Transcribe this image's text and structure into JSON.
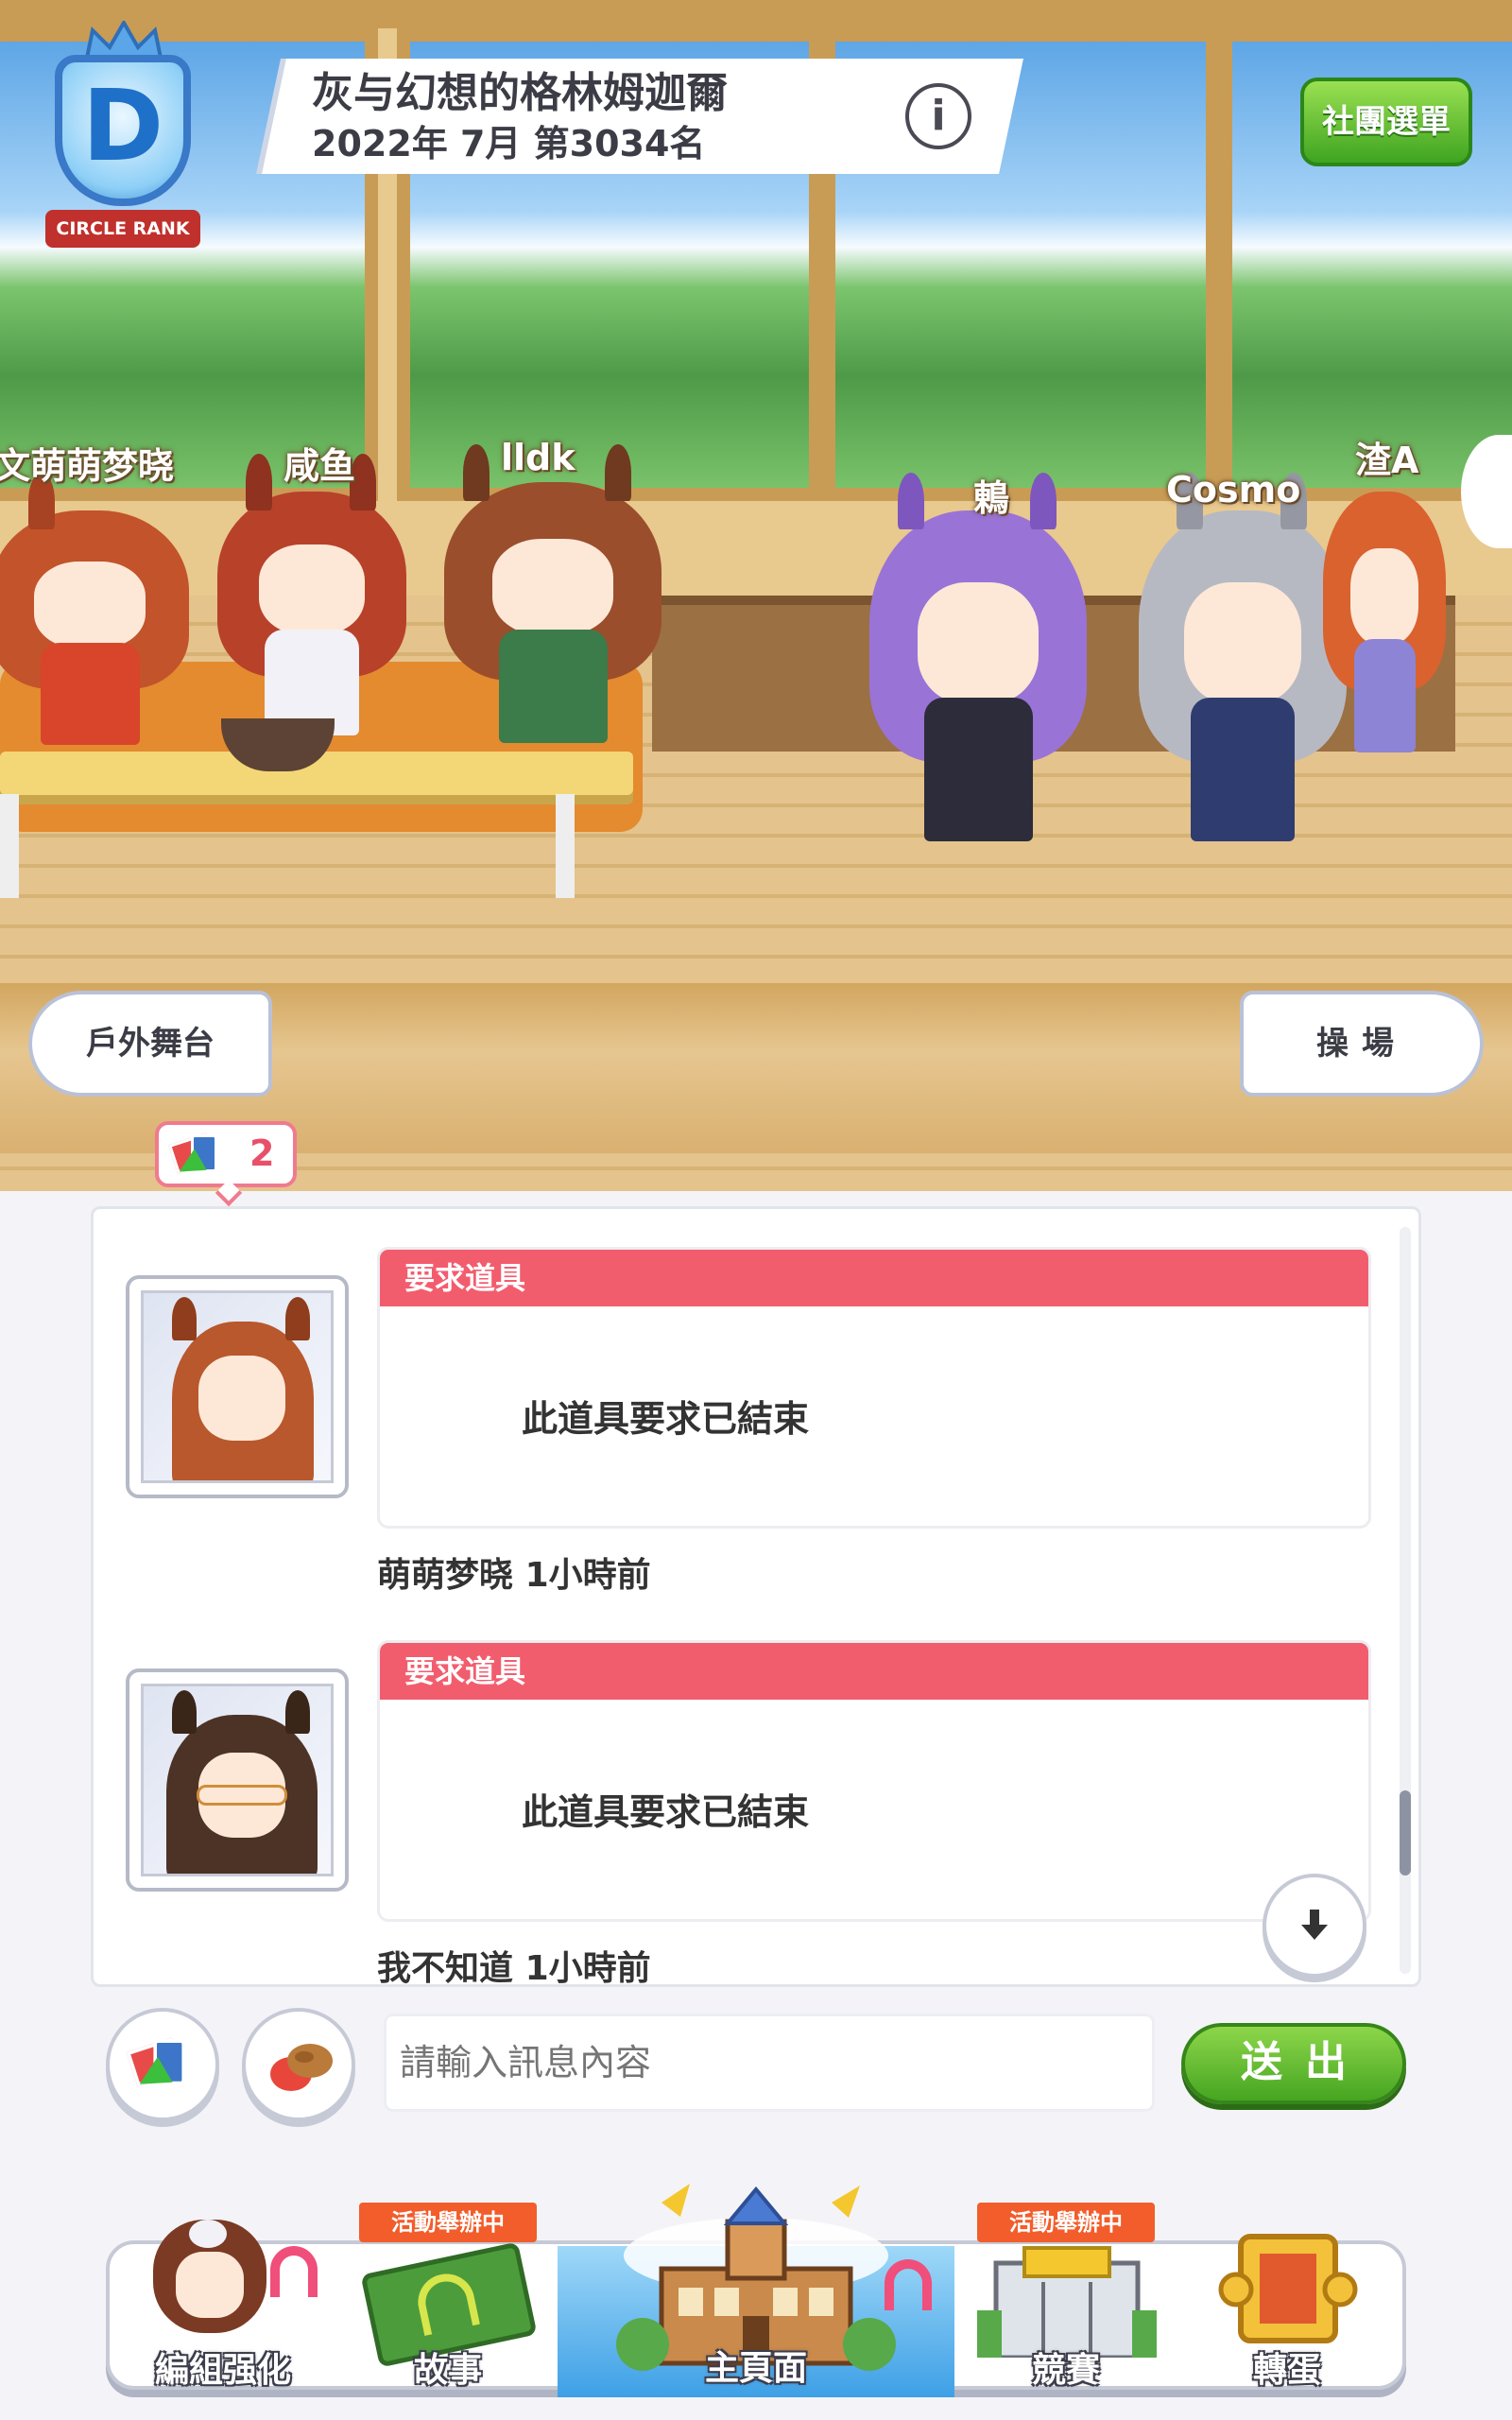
{
  "circle": {
    "rank_letter": "D",
    "rank_label": "CIRCLE RANK",
    "name": "灰与幻想的格林姆迦爾",
    "ranking_text": "2022年 7月 第3034名"
  },
  "header": {
    "info_label": "i",
    "menu_button": "社團選單"
  },
  "members": [
    {
      "name": "萌萌梦晓",
      "prefix": "文"
    },
    {
      "name": "咸鱼"
    },
    {
      "name": "lldk"
    },
    {
      "name": "鶇"
    },
    {
      "name": "Cosmo"
    },
    {
      "name": "渣A"
    }
  ],
  "nav": {
    "left": "戶外舞台",
    "right": "操場"
  },
  "item_badge": {
    "count": "2"
  },
  "messages": [
    {
      "type_label": "要求道具",
      "body": "此道具要求已結束",
      "sender": "萌萌梦晓",
      "time": "1小時前"
    },
    {
      "type_label": "要求道具",
      "body": "此道具要求已結束",
      "sender": "我不知道",
      "time": "1小時前"
    }
  ],
  "input": {
    "placeholder": "請輸入訊息內容",
    "send_label": "送出"
  },
  "bottom_nav": {
    "tabs": [
      {
        "label": "編組强化"
      },
      {
        "label": "故事",
        "badge": "活動舉辦中"
      },
      {
        "label": "主頁面",
        "active": true
      },
      {
        "label": "競賽",
        "badge": "活動舉辦中"
      },
      {
        "label": "轉蛋"
      }
    ]
  },
  "colors": {
    "accent_red": "#f25d6e",
    "send_green": "#46a521",
    "active_tab": "#3ea0e6"
  }
}
